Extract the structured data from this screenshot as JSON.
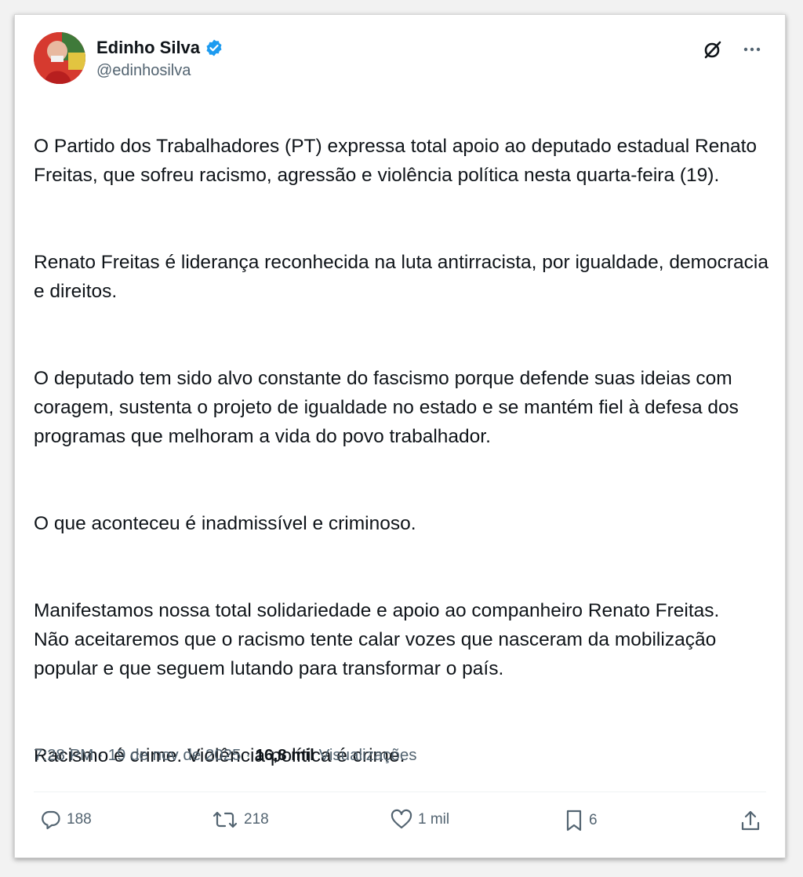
{
  "author": {
    "display_name": "Edinho Silva",
    "handle": "@edinhosilva",
    "verified": true,
    "avatar": "avatar-photo"
  },
  "header_icons": [
    "grok-icon",
    "more-icon"
  ],
  "tweet": {
    "paragraphs": [
      "O Partido dos Trabalhadores (PT) expressa total apoio ao deputado estadual Renato Freitas, que sofreu racismo, agressão e violência política nesta quarta-feira (19).",
      "Renato Freitas é  liderança reconhecida na luta antirracista, por igualdade, democracia e direitos.",
      "O deputado tem sido alvo constante do fascismo porque defende suas ideias com coragem, sustenta o projeto de igualdade no estado e se mantém fiel à defesa dos programas que melhoram a vida do povo trabalhador.",
      "O que aconteceu é inadmissível e criminoso.",
      "Manifestamos nossa total solidariedade e apoio ao companheiro Renato Freitas.\nNão aceitaremos que o racismo tente calar vozes que nasceram da mobilização popular e que seguem lutando para transformar o país.",
      "Racismo é crime. Violência política é crime."
    ]
  },
  "meta": {
    "time": "7:28 PM",
    "separator": " · ",
    "date": "19 de nov de 2025",
    "views_count": "16,8 mil",
    "views_label": "Visualizações"
  },
  "actions": {
    "replies": "188",
    "reposts": "218",
    "likes": "1 mil",
    "bookmarks": "6"
  },
  "colors": {
    "verified": "#1d9bf0",
    "text": "#0f1419",
    "secondary": "#536471"
  }
}
